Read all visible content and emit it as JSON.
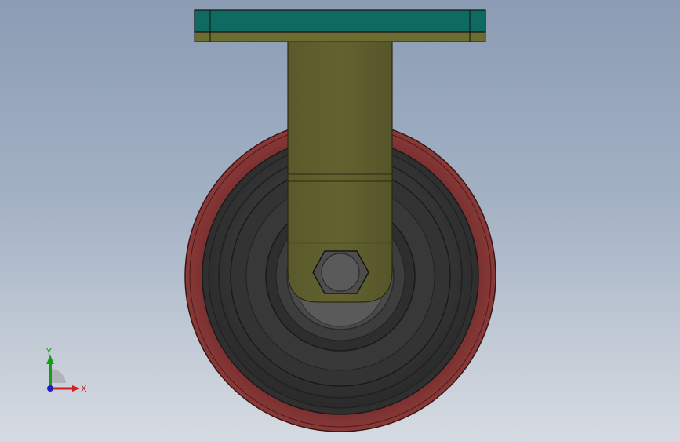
{
  "viewport": {
    "background_top": "#8b9cb4",
    "background_bottom": "#d6dbe2"
  },
  "model": {
    "name": "caster-wheel",
    "colors": {
      "mount_plate": "#0f6b61",
      "mount_plate_lower": "#6a6a2e",
      "fork": "#5f5e2f",
      "tire": "#7a2e2e",
      "hub": "#3a3a3a",
      "bolt": "#555555"
    }
  },
  "triad": {
    "x_label": "X",
    "y_label": "Y",
    "x_color": "#d02020",
    "y_color": "#1a9a1a",
    "z_color": "#2020c8"
  }
}
